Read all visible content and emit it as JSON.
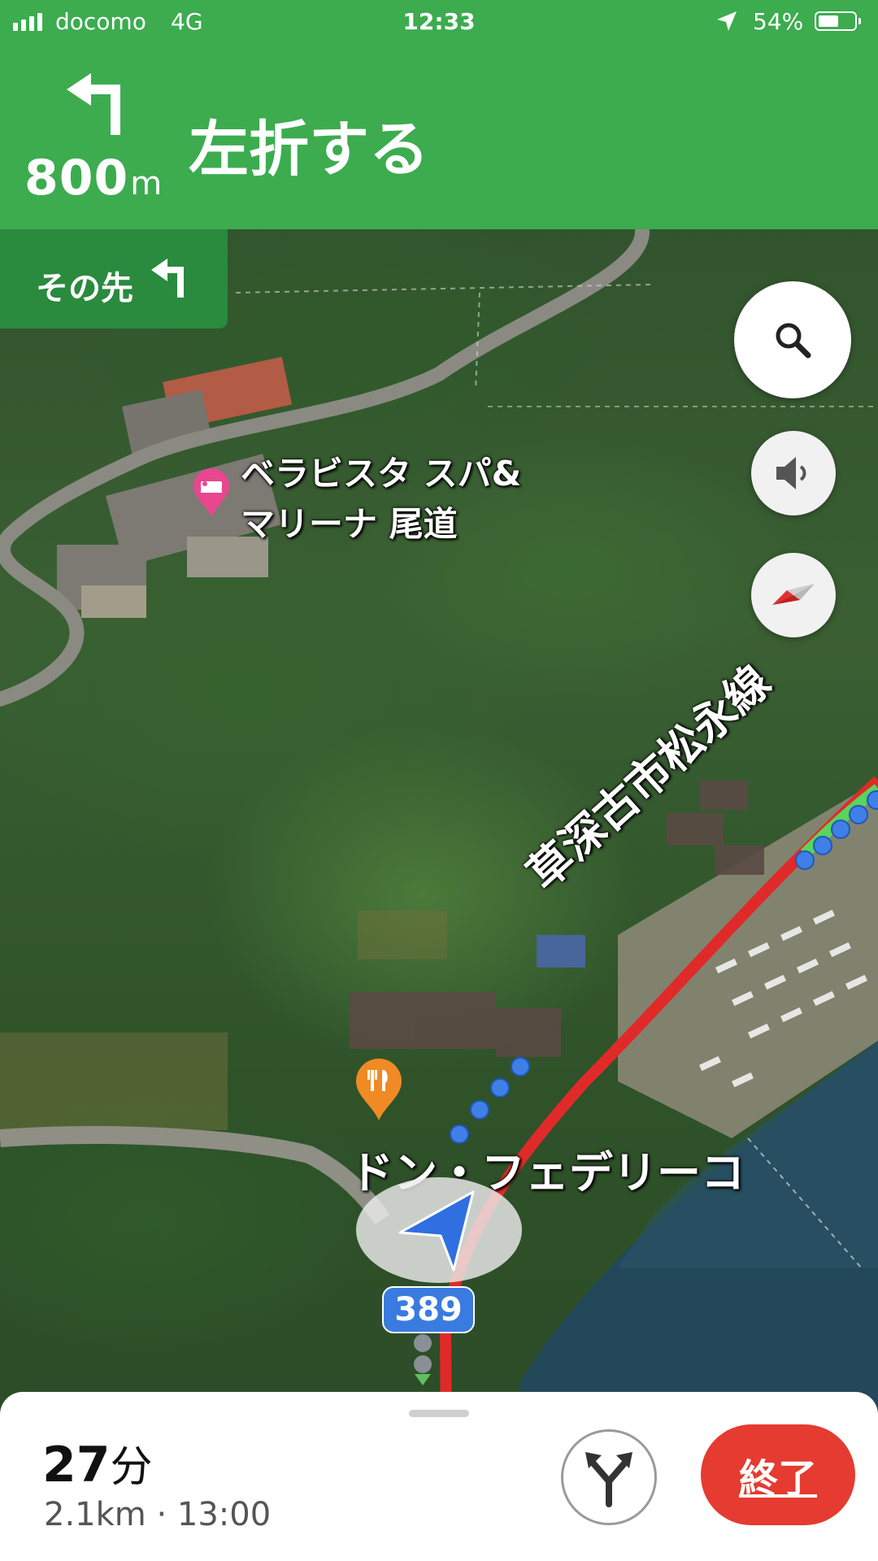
{
  "status_bar": {
    "carrier": "docomo",
    "network": "4G",
    "time": "12:33",
    "battery_percent": "54%",
    "battery_level": 0.54
  },
  "navigation": {
    "turn_icon": "turn-left-arrow-icon",
    "distance_value": "800",
    "distance_unit": "m",
    "instruction": "左折する",
    "then_label": "その先",
    "then_icon": "turn-left-small-icon",
    "header_color": "#3cac4f"
  },
  "map": {
    "poi_hotel_name": "ベラビスタ スパ&\nマリーナ 尾道",
    "poi_hotel_icon": "hotel-pin-icon",
    "poi_restaurant_name": "ドン・フェデリーコ",
    "poi_restaurant_icon": "restaurant-pin-icon",
    "road_name": "草深古市松永線",
    "route_number": "389",
    "route_color": "#3a7be0"
  },
  "controls": {
    "search_icon": "search-icon",
    "sound_icon": "speaker-icon",
    "compass_icon": "compass-icon"
  },
  "eta": {
    "duration_value": "27",
    "duration_unit": "分",
    "meta": "2.1km · 13:00",
    "alternate_routes_icon": "alternate-routes-icon",
    "end_label": "終了",
    "end_color": "#e53b30"
  }
}
